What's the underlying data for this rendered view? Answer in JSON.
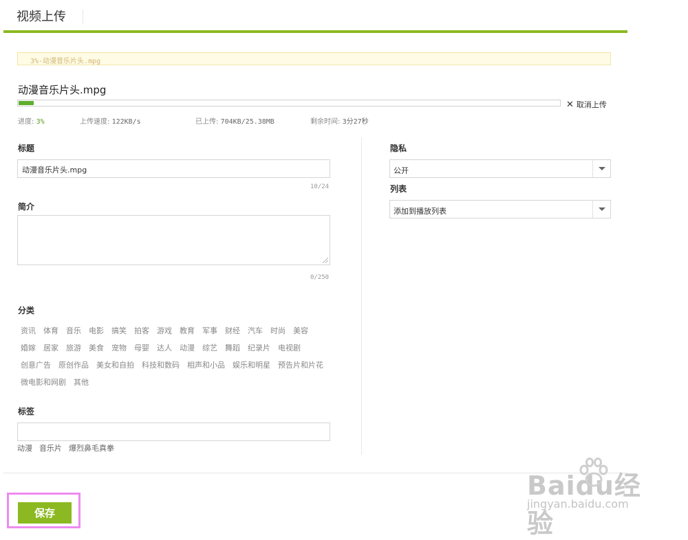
{
  "header": {
    "title": "视频上传"
  },
  "notice": {
    "text": "3%-动漫音乐片头.mpg"
  },
  "upload": {
    "file_name": "动漫音乐片头.mpg",
    "progress_fraction": 0.03,
    "cancel_label": "取消上传",
    "cancel_icon": "close-icon",
    "stats": {
      "progress_label": "进度:",
      "progress_value": "3%",
      "speed_label": "上传速度:",
      "speed_value": "122KB/s",
      "uploaded_label": "已上传:",
      "uploaded_value": "704KB/25.38MB",
      "remaining_label": "剩余时间:",
      "remaining_value": "3分27秒"
    }
  },
  "form": {
    "title_label": "标题",
    "title_value": "动漫音乐片头.mpg",
    "title_counter": "10/24",
    "desc_label": "简介",
    "desc_value": "",
    "desc_counter": "0/250",
    "category_label": "分类",
    "categories": [
      [
        "资讯",
        "体育",
        "音乐",
        "电影",
        "搞笑",
        "拍客",
        "游戏",
        "教育",
        "军事",
        "财经",
        "汽车",
        "时尚",
        "美容"
      ],
      [
        "婚嫁",
        "居家",
        "旅游",
        "美食",
        "宠物",
        "母婴",
        "达人",
        "动漫",
        "综艺",
        "舞蹈",
        "纪录片",
        "电视剧"
      ],
      [
        "创意广告",
        "原创作品",
        "美女和自拍",
        "科技和数码",
        "相声和小品",
        "娱乐和明星",
        "预告片和片花"
      ],
      [
        "微电影和网剧",
        "其他"
      ]
    ],
    "tags_label": "标签",
    "tags_value": "",
    "tag_suggestions": [
      "动漫",
      "音乐片",
      "爆烈鼻毛真拳"
    ]
  },
  "settings": {
    "privacy_label": "隐私",
    "privacy_value": "公开",
    "list_label": "列表",
    "list_value": "添加到播放列表",
    "dropdown_icon": "chevron-down-icon"
  },
  "actions": {
    "save_label": "保存"
  },
  "watermark": {
    "logo": "Baidu经验",
    "sub": "jingyan.baidu.com"
  },
  "colors": {
    "accent": "#8cb921",
    "progress": "#5fae2c",
    "highlight": "#ee8bf0"
  }
}
